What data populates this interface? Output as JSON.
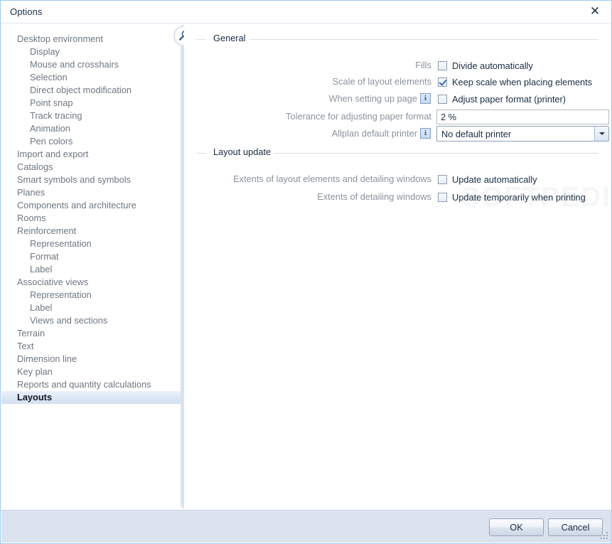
{
  "window": {
    "title": "Options",
    "close_icon": "close-icon"
  },
  "sidebar": {
    "info_icon": "info-icon",
    "items": [
      {
        "label": "Desktop environment",
        "level": 1,
        "selected": false
      },
      {
        "label": "Display",
        "level": 2,
        "selected": false
      },
      {
        "label": "Mouse and crosshairs",
        "level": 2,
        "selected": false
      },
      {
        "label": "Selection",
        "level": 2,
        "selected": false
      },
      {
        "label": "Direct object modification",
        "level": 2,
        "selected": false
      },
      {
        "label": "Point snap",
        "level": 2,
        "selected": false
      },
      {
        "label": "Track tracing",
        "level": 2,
        "selected": false
      },
      {
        "label": "Animation",
        "level": 2,
        "selected": false
      },
      {
        "label": "Pen colors",
        "level": 2,
        "selected": false
      },
      {
        "label": "Import and export",
        "level": 1,
        "selected": false
      },
      {
        "label": "Catalogs",
        "level": 1,
        "selected": false
      },
      {
        "label": "Smart symbols and symbols",
        "level": 1,
        "selected": false
      },
      {
        "label": "Planes",
        "level": 1,
        "selected": false
      },
      {
        "label": "Components and architecture",
        "level": 1,
        "selected": false
      },
      {
        "label": "Rooms",
        "level": 1,
        "selected": false
      },
      {
        "label": "Reinforcement",
        "level": 1,
        "selected": false
      },
      {
        "label": "Representation",
        "level": 2,
        "selected": false
      },
      {
        "label": "Format",
        "level": 2,
        "selected": false
      },
      {
        "label": "Label",
        "level": 2,
        "selected": false
      },
      {
        "label": "Associative views",
        "level": 1,
        "selected": false
      },
      {
        "label": "Representation",
        "level": 2,
        "selected": false
      },
      {
        "label": "Label",
        "level": 2,
        "selected": false
      },
      {
        "label": "Views and sections",
        "level": 2,
        "selected": false
      },
      {
        "label": "Terrain",
        "level": 1,
        "selected": false
      },
      {
        "label": "Text",
        "level": 1,
        "selected": false
      },
      {
        "label": "Dimension line",
        "level": 1,
        "selected": false
      },
      {
        "label": "Key plan",
        "level": 1,
        "selected": false
      },
      {
        "label": "Reports and quantity calculations",
        "level": 1,
        "selected": false
      },
      {
        "label": "Layouts",
        "level": 1,
        "selected": true
      }
    ]
  },
  "accent": {
    "icon": "magnifier-icon"
  },
  "content": {
    "general": {
      "title": "General",
      "fills": {
        "label": "Fills",
        "checkbox_label": "Divide automatically",
        "checked": false
      },
      "scale": {
        "label": "Scale of layout elements",
        "checkbox_label": "Keep scale when placing elements",
        "checked": true
      },
      "setup_page": {
        "label": "When setting up page",
        "info_icon": "info-icon",
        "checkbox_label": "Adjust paper format (printer)",
        "checked": false
      },
      "tolerance": {
        "label": "Tolerance for adjusting paper format",
        "value": "2 %"
      },
      "printer": {
        "label": "Allplan default printer",
        "info_icon": "info-icon",
        "value": "No default printer",
        "dropdown_icon": "chevron-down-icon"
      }
    },
    "layout_update": {
      "title": "Layout update",
      "extents_layout": {
        "label": "Extents of layout elements and detailing windows",
        "checkbox_label": "Update automatically",
        "checked": false
      },
      "extents_detailing": {
        "label": "Extents of detailing windows",
        "checkbox_label": "Update temporarily when printing",
        "checked": false
      }
    },
    "watermark": "SOFTPEDIA"
  },
  "footer": {
    "ok_label": "OK",
    "cancel_label": "Cancel"
  }
}
